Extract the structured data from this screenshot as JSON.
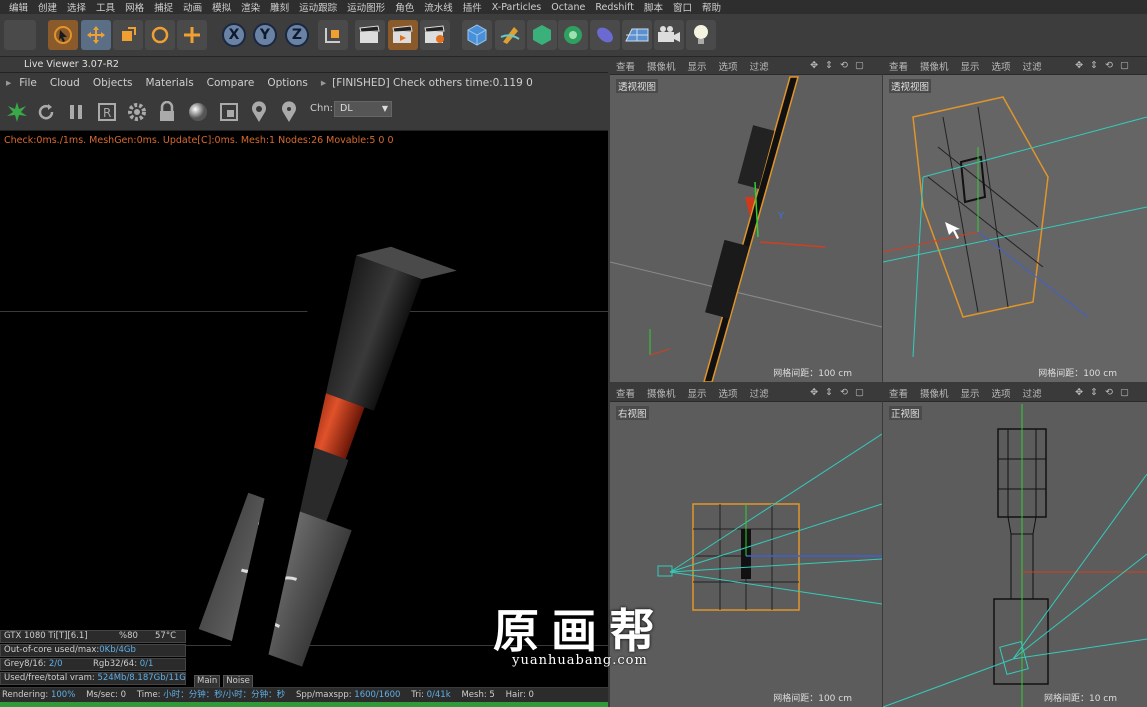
{
  "menubar": [
    "编辑",
    "创建",
    "选择",
    "工具",
    "网格",
    "捕捉",
    "动画",
    "模拟",
    "渲染",
    "雕刻",
    "运动跟踪",
    "运动图形",
    "角色",
    "流水线",
    "插件",
    "X-Particles",
    "Octane",
    "Redshift",
    "脚本",
    "窗口",
    "帮助"
  ],
  "toolbar": {
    "xyz": [
      "X",
      "Y",
      "Z"
    ]
  },
  "live_viewer": {
    "title": "Live Viewer 3.07-R2",
    "menu": [
      "File",
      "Cloud",
      "Objects",
      "Materials",
      "Compare",
      "Options"
    ],
    "menu_arrow": "▸",
    "finished": "[FINISHED] Check others time:0.119  0",
    "chn_label": "Chn:",
    "chn_value": "DL",
    "status": "Check:0ms./1ms. MeshGen:0ms. Update[C]:0ms. Mesh:1 Nodes:26 Movable:5  0 0",
    "info": {
      "gpu": "GTX 1080 Ti[T][6.1]",
      "gpu_pct": "%80",
      "gpu_temp": "57°C",
      "ooc_label": "Out-of-core used/max:",
      "ooc_value": "0Kb/4Gb",
      "grey_label": "Grey8/16: ",
      "grey_value": "2/0",
      "rgb_label": "Rgb32/64: ",
      "rgb_value": "0/1",
      "vram_label": "Used/free/total vram: ",
      "vram_value": "524Mb/8.187Gb/11G"
    },
    "tabs": [
      "Main",
      "Noise"
    ],
    "render_status": {
      "rendering_label": "Rendering: ",
      "rendering_value": "100%",
      "ms_label": "Ms/sec: ",
      "ms_value": "0",
      "time_label": "Time: ",
      "time_value": "小时：分钟：秒/小时：分钟：秒",
      "spp_label": "Spp/maxspp: ",
      "spp_value": "1600/1600",
      "tri_label": "Tri: ",
      "tri_value": "0/41k",
      "mesh_label": "Mesh: ",
      "mesh_value": "5",
      "hair_label": "Hair: ",
      "hair_value": "0"
    },
    "progress": 1.0
  },
  "viewports": [
    {
      "menu": [
        "查看",
        "摄像机",
        "显示",
        "选项",
        "过滤"
      ],
      "name": "透视视图",
      "scale": "网格间距：100 cm"
    },
    {
      "menu": [
        "查看",
        "摄像机",
        "显示",
        "选项",
        "过滤"
      ],
      "name": "透视视图",
      "scale": "网格间距：100 cm"
    },
    {
      "menu": [
        "查看",
        "摄像机",
        "显示",
        "选项",
        "过滤"
      ],
      "name": "右视图",
      "scale": "网格间距：100 cm"
    },
    {
      "menu": [
        "查看",
        "摄像机",
        "显示",
        "选项",
        "过滤"
      ],
      "name": "正视图",
      "scale": "网格间距：10 cm"
    }
  ],
  "watermark": {
    "title": "原画帮",
    "url": "yuanhuabang.com"
  },
  "colors": {
    "accent_orange": "#e0952a",
    "status_orange": "#d86a2c",
    "value_blue": "#5fb0e8",
    "progress_green": "#2f9a3a"
  }
}
